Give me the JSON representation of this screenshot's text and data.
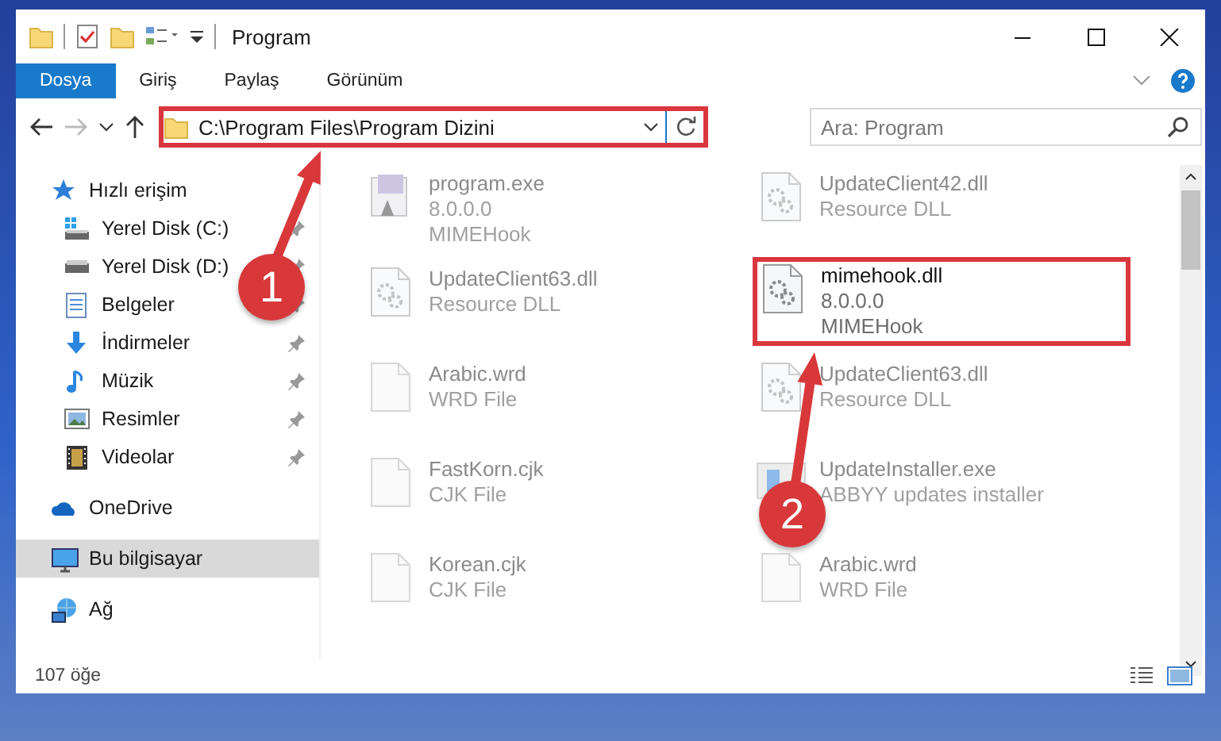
{
  "window": {
    "title": "Program"
  },
  "ribbon_tabs": [
    {
      "label": "Dosya",
      "selected": true
    },
    {
      "label": "Giriş",
      "selected": false
    },
    {
      "label": "Paylaş",
      "selected": false
    },
    {
      "label": "Görünüm",
      "selected": false
    }
  ],
  "address_bar": {
    "path": "C:\\Program Files\\Program Dizini",
    "highlighted": true
  },
  "search": {
    "placeholder": "Ara: Program"
  },
  "sidebar": {
    "items": [
      {
        "label": "Hızlı erişim",
        "kind": "quick",
        "selected": false,
        "children": [
          {
            "label": "Yerel Disk (C:)",
            "kind": "drive-c",
            "pinned": true,
            "selected": false
          },
          {
            "label": "Yerel Disk (D:)",
            "kind": "drive",
            "pinned": true,
            "selected": false
          },
          {
            "label": "Belgeler",
            "kind": "documents",
            "pinned": true,
            "selected": false
          },
          {
            "label": "İndirmeler",
            "kind": "downloads",
            "pinned": true,
            "selected": false
          },
          {
            "label": "Müzik",
            "kind": "music",
            "pinned": true,
            "selected": false
          },
          {
            "label": "Resimler",
            "kind": "pictures",
            "pinned": true,
            "selected": false
          },
          {
            "label": "Videolar",
            "kind": "videos",
            "pinned": true,
            "selected": false
          }
        ]
      },
      {
        "label": "OneDrive",
        "kind": "cloud",
        "selected": false
      },
      {
        "label": "Bu bilgisayar",
        "kind": "computer",
        "selected": true
      },
      {
        "label": "Ağ",
        "kind": "network",
        "selected": false
      }
    ]
  },
  "files": [
    {
      "name": "program.exe",
      "lines": [
        "8.0.0.0",
        "MIMEHook"
      ],
      "kind": "exe",
      "blurred": true,
      "highlighted": false
    },
    {
      "name": "UpdateClient42.dll",
      "lines": [
        "Resource DLL"
      ],
      "kind": "dll",
      "blurred": true,
      "highlighted": false
    },
    {
      "name": "UpdateClient63.dll",
      "lines": [
        "Resource DLL"
      ],
      "kind": "dll",
      "blurred": true,
      "highlighted": false
    },
    {
      "name": "mimehook.dll",
      "lines": [
        "8.0.0.0",
        "MIMEHook"
      ],
      "kind": "dll",
      "blurred": false,
      "highlighted": true
    },
    {
      "name": "Arabic.wrd",
      "lines": [
        "WRD File"
      ],
      "kind": "blank",
      "blurred": true,
      "highlighted": false
    },
    {
      "name": "UpdateClient63.dll",
      "lines": [
        "Resource DLL"
      ],
      "kind": "dll",
      "blurred": true,
      "highlighted": false
    },
    {
      "name": "FastKorn.cjk",
      "lines": [
        "CJK File"
      ],
      "kind": "blank",
      "blurred": true,
      "highlighted": false
    },
    {
      "name": "UpdateInstaller.exe",
      "lines": [
        "ABBYY updates installer"
      ],
      "kind": "installer",
      "blurred": true,
      "highlighted": false
    },
    {
      "name": "Korean.cjk",
      "lines": [
        "CJK File"
      ],
      "kind": "blank",
      "blurred": true,
      "highlighted": false
    },
    {
      "name": "Arabic.wrd",
      "lines": [
        "WRD File"
      ],
      "kind": "blank",
      "blurred": true,
      "highlighted": false
    }
  ],
  "status_bar": {
    "count": "107 öğe"
  },
  "annotations": [
    {
      "number": "1"
    },
    {
      "number": "2"
    }
  ]
}
